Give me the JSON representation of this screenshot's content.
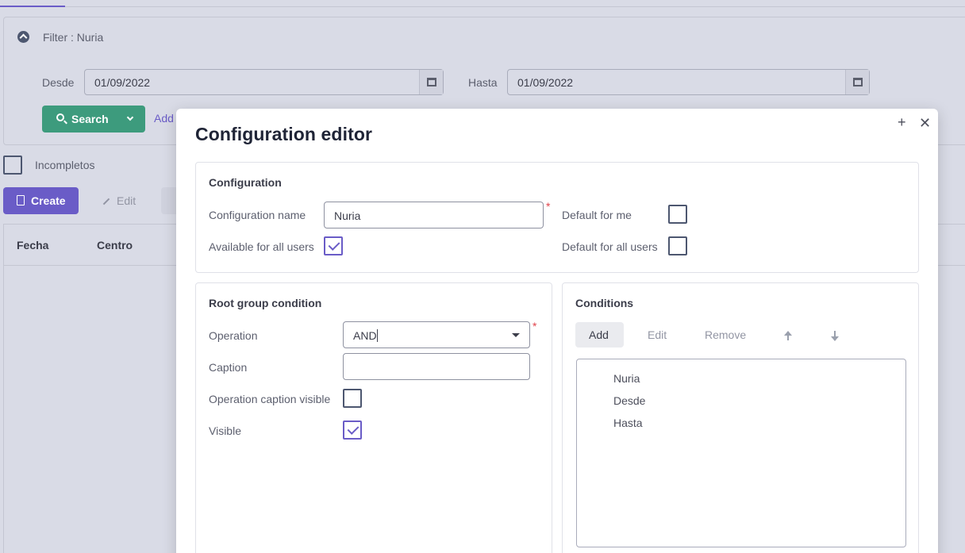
{
  "background": {
    "filter": {
      "title": "Filter : Nuria",
      "desde_label": "Desde",
      "desde_value": "01/09/2022",
      "hasta_label": "Hasta",
      "hasta_value": "01/09/2022",
      "search_label": "Search",
      "add_link": "Add"
    },
    "incompletos_label": "Incompletos",
    "toolbar": {
      "create_label": "Create",
      "edit_label": "Edit"
    },
    "grid": {
      "columns": [
        "Fecha",
        "Centro"
      ]
    }
  },
  "modal": {
    "title": "Configuration editor",
    "maximize_glyph": "+",
    "close_glyph": "✕",
    "configuration": {
      "title": "Configuration",
      "name_label": "Configuration name",
      "name_value": "Nuria",
      "available_label": "Available for all users",
      "available_checked": true,
      "default_me_label": "Default for me",
      "default_me_checked": false,
      "default_all_label": "Default for all users",
      "default_all_checked": false,
      "required_mark": "*"
    },
    "root_group": {
      "title": "Root group condition",
      "operation_label": "Operation",
      "operation_value": "AND",
      "caption_label": "Caption",
      "caption_value": "",
      "op_caption_visible_label": "Operation caption visible",
      "op_caption_visible_checked": false,
      "visible_label": "Visible",
      "visible_checked": true,
      "required_mark": "*"
    },
    "conditions": {
      "title": "Conditions",
      "add_label": "Add",
      "edit_label": "Edit",
      "remove_label": "Remove",
      "items": [
        "Nuria",
        "Desde",
        "Hasta"
      ]
    }
  },
  "colors": {
    "accent": "#6a5cc7",
    "search_green": "#3d9b7d",
    "required_red": "#e0424a",
    "overlay_bg": "#d9dbe6"
  }
}
